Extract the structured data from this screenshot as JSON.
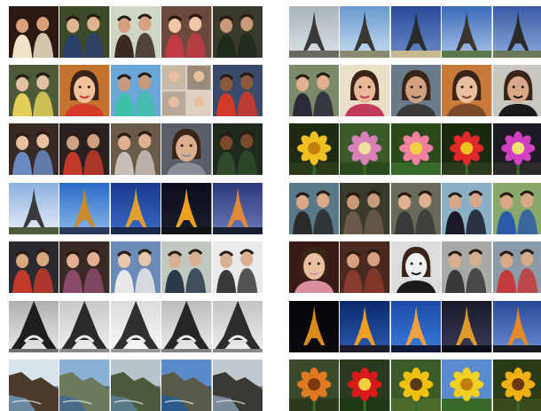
{
  "layout_caption": "",
  "left_column": {
    "rows": [
      {
        "name": "row-1-people-night",
        "tiles": [
          {
            "kind": "people",
            "bg": "#2a1a12",
            "fg": "#d9a07a",
            "accent": "#f2e3c8"
          },
          {
            "kind": "people",
            "bg": "#3c4a2a",
            "fg": "#e0b48f",
            "accent": "#2b3f6b"
          },
          {
            "kind": "people",
            "bg": "#cfd6c3",
            "fg": "#d6a17d",
            "accent": "#3a2a22"
          },
          {
            "kind": "people",
            "bg": "#6b4a3c",
            "fg": "#f0c8a8",
            "accent": "#c23a44"
          },
          {
            "kind": "people",
            "bg": "#3a3a2a",
            "fg": "#c89a7a",
            "accent": "#1e2a1a"
          }
        ]
      },
      {
        "name": "row-2-portraits",
        "tiles": [
          {
            "kind": "people",
            "bg": "#4c5a3a",
            "fg": "#e0c0a0",
            "accent": "#e2d05a"
          },
          {
            "kind": "portrait",
            "bg": "#c2742e",
            "fg": "#f2c39a",
            "accent": "#d23a2a"
          },
          {
            "kind": "people",
            "bg": "#6aa6d8",
            "fg": "#c89a7a",
            "accent": "#3ec0a8"
          },
          {
            "kind": "collage",
            "bg": "#d8d2c8",
            "fg": "#e8c0a0",
            "accent": "#7a5a48"
          },
          {
            "kind": "people",
            "bg": "#3a4a6a",
            "fg": "#8a5a3a",
            "accent": "#d43a2a"
          }
        ]
      },
      {
        "name": "row-3-indoor",
        "tiles": [
          {
            "kind": "people",
            "bg": "#3a2a24",
            "fg": "#e8c0a0",
            "accent": "#6a8ac0"
          },
          {
            "kind": "people",
            "bg": "#2a2220",
            "fg": "#d0a080",
            "accent": "#c23a2a"
          },
          {
            "kind": "people",
            "bg": "#6a5a4a",
            "fg": "#e0b090",
            "accent": "#c8c0b8"
          },
          {
            "kind": "portrait",
            "bg": "#5a5e68",
            "fg": "#d8b090",
            "accent": "#8a8e98"
          },
          {
            "kind": "people",
            "bg": "#1e2a1e",
            "fg": "#7a4a2a",
            "accent": "#2e4a2a"
          }
        ]
      },
      {
        "name": "row-4-eiffel-dusk",
        "tiles": [
          {
            "kind": "tower",
            "sky": "#8ab0e0",
            "sky2": "#e8eef6",
            "tower": "#3a3a3a",
            "ground": "#4a5a3a"
          },
          {
            "kind": "tower",
            "sky": "#2a6ac8",
            "sky2": "#8ab8e8",
            "tower": "#c88a2a",
            "ground": "#2a3a5a"
          },
          {
            "kind": "tower",
            "sky": "#1a3a8a",
            "sky2": "#3a6ac8",
            "tower": "#e0a030",
            "ground": "#1a2a4a"
          },
          {
            "kind": "tower",
            "sky": "#0a0e1a",
            "sky2": "#1a1e2e",
            "tower": "#f0a020",
            "ground": "#101418"
          },
          {
            "kind": "tower",
            "sky": "#2a3a7a",
            "sky2": "#6a7ab8",
            "tower": "#e08a3a",
            "ground": "#1a2030"
          }
        ]
      },
      {
        "name": "row-5-groups",
        "tiles": [
          {
            "kind": "people",
            "bg": "#2a2a30",
            "fg": "#d8a880",
            "accent": "#c23a2a"
          },
          {
            "kind": "people",
            "bg": "#3a2a26",
            "fg": "#e0b090",
            "accent": "#8a4a6a"
          },
          {
            "kind": "people",
            "bg": "#6a8ab8",
            "fg": "#e8c8a8",
            "accent": "#e8e8e8"
          },
          {
            "kind": "people",
            "bg": "#c0c8c0",
            "fg": "#d8b090",
            "accent": "#2a3a4a"
          },
          {
            "kind": "people",
            "bg": "#e8eaec",
            "fg": "#d8b090",
            "accent": "#3a3a3a"
          }
        ]
      },
      {
        "name": "row-6-eiffel-bw",
        "tiles": [
          {
            "kind": "towerbase",
            "sky": "#b0b0b0",
            "sky2": "#e8e8e8",
            "tower": "#1e1e1e",
            "ground": "#707070"
          },
          {
            "kind": "towerbase",
            "sky": "#c8c8c8",
            "sky2": "#f0f0f0",
            "tower": "#2a2a2a",
            "ground": "#8a8a8a"
          },
          {
            "kind": "towerbase",
            "sky": "#dcdcdc",
            "sky2": "#f8f8f8",
            "tower": "#303030",
            "ground": "#9a9a9a"
          },
          {
            "kind": "towerbase",
            "sky": "#bcbcbc",
            "sky2": "#ececec",
            "tower": "#262626",
            "ground": "#808080"
          },
          {
            "kind": "towerbase",
            "sky": "#c4c4c4",
            "sky2": "#eeeeee",
            "tower": "#2c2c2c",
            "ground": "#888888"
          }
        ]
      },
      {
        "name": "row-7-coast",
        "tiles": [
          {
            "kind": "coast",
            "sky": "#d8e4ec",
            "water": "#6a8aa0",
            "land": "#4a3a2a"
          },
          {
            "kind": "coast",
            "sky": "#8ab0d8",
            "water": "#4a6a8a",
            "land": "#6a7a5a"
          },
          {
            "kind": "coast",
            "sky": "#b8c4cc",
            "water": "#5a7a8a",
            "land": "#4a5a3a"
          },
          {
            "kind": "coast",
            "sky": "#5a8ac8",
            "water": "#2a5a8a",
            "land": "#5a5a4a"
          },
          {
            "kind": "coast",
            "sky": "#c0c8d0",
            "water": "#7a8a98",
            "land": "#3a3a34"
          }
        ]
      }
    ]
  },
  "right_column": {
    "rows": [
      {
        "name": "row-1-eiffel-day",
        "tiles": [
          {
            "kind": "tower",
            "sky": "#a8b4bc",
            "sky2": "#dce2e6",
            "tower": "#3a3a3a",
            "ground": "#6a6a60"
          },
          {
            "kind": "tower",
            "sky": "#6a9ad0",
            "sky2": "#c8dcf0",
            "tower": "#3a3630",
            "ground": "#8a8a70"
          },
          {
            "kind": "tower",
            "sky": "#2a4a9a",
            "sky2": "#6a8ac8",
            "tower": "#2a2a2a",
            "ground": "#c8b890"
          },
          {
            "kind": "tower",
            "sky": "#3a6ab8",
            "sky2": "#a8c4e8",
            "tower": "#3a342a",
            "ground": "#5a7a4a"
          },
          {
            "kind": "tower",
            "sky": "#3a5aa8",
            "sky2": "#8aaad8",
            "tower": "#2a2a2a",
            "ground": "#6a7a5a"
          }
        ]
      },
      {
        "name": "row-2-faces",
        "tiles": [
          {
            "kind": "people",
            "bg": "#7a8a6a",
            "fg": "#e0b090",
            "accent": "#2a2a3a"
          },
          {
            "kind": "portrait",
            "bg": "#eae0c8",
            "fg": "#e8b898",
            "accent": "#c23a5a"
          },
          {
            "kind": "portrait",
            "bg": "#6a7a8a",
            "fg": "#d0a080",
            "accent": "#3a3a3a"
          },
          {
            "kind": "portrait",
            "bg": "#c87a3a",
            "fg": "#e8c0a0",
            "accent": "#7a4a2a"
          },
          {
            "kind": "portrait",
            "bg": "#c8c8c0",
            "fg": "#d8a888",
            "accent": "#1a1a1a"
          }
        ]
      },
      {
        "name": "row-3-flowers",
        "tiles": [
          {
            "kind": "flower",
            "bg": "#1e2a12",
            "petal": "#f0c020",
            "center": "#c08010",
            "ground": "#2a3a18"
          },
          {
            "kind": "flower",
            "bg": "#3a5a2a",
            "petal": "#d880b8",
            "center": "#f0e0a0",
            "ground": "#2a4a1e"
          },
          {
            "kind": "flower",
            "bg": "#2a4a1a",
            "petal": "#f080a0",
            "center": "#f0d040",
            "ground": "#3a6a2a"
          },
          {
            "kind": "flower",
            "bg": "#1a2a10",
            "petal": "#e02a2a",
            "center": "#f0c020",
            "ground": "#2a3a1a"
          },
          {
            "kind": "flower",
            "bg": "#1e1a24",
            "petal": "#d040c0",
            "center": "#f0e070",
            "ground": "#2a2a2a"
          }
        ]
      },
      {
        "name": "row-4-outdoor",
        "tiles": [
          {
            "kind": "people",
            "bg": "#5a7a8a",
            "fg": "#d8a888",
            "accent": "#2a2a2a"
          },
          {
            "kind": "people",
            "bg": "#3a3a2a",
            "fg": "#c89a7a",
            "accent": "#6a5a4a"
          },
          {
            "kind": "people",
            "bg": "#6a6a5a",
            "fg": "#e0b090",
            "accent": "#3a3a3a"
          },
          {
            "kind": "people",
            "bg": "#8ab0c8",
            "fg": "#d8a888",
            "accent": "#1a1a2a"
          },
          {
            "kind": "people",
            "bg": "#8aa86a",
            "fg": "#d8a888",
            "accent": "#2a5aa8"
          }
        ]
      },
      {
        "name": "row-5-portraits",
        "tiles": [
          {
            "kind": "portrait",
            "bg": "#3a1a14",
            "fg": "#e8c0a0",
            "accent": "#d890a0"
          },
          {
            "kind": "people",
            "bg": "#4a2a1e",
            "fg": "#d8a080",
            "accent": "#8a3a2a"
          },
          {
            "kind": "portrait",
            "bg": "#dcdcdc",
            "fg": "#f0f0f0",
            "accent": "#1a1a1a"
          },
          {
            "kind": "people",
            "bg": "#a8aaa8",
            "fg": "#d8b090",
            "accent": "#3a3a3a"
          },
          {
            "kind": "people",
            "bg": "#8a9aa8",
            "fg": "#d8a888",
            "accent": "#c23a3a"
          }
        ]
      },
      {
        "name": "row-6-eiffel-night",
        "tiles": [
          {
            "kind": "tower",
            "sky": "#050508",
            "sky2": "#0a0a10",
            "tower": "#d88a1a",
            "ground": "#0a0a0a"
          },
          {
            "kind": "tower",
            "sky": "#0a2a6a",
            "sky2": "#2a5ab0",
            "tower": "#f0a020",
            "ground": "#1a1a2a"
          },
          {
            "kind": "tower",
            "sky": "#1a4aa8",
            "sky2": "#3a7ad8",
            "tower": "#f0a040",
            "ground": "#10183a"
          },
          {
            "kind": "tower",
            "sky": "#1a1a2a",
            "sky2": "#3a3a5a",
            "tower": "#e09a2a",
            "ground": "#0e0e16"
          },
          {
            "kind": "tower",
            "sky": "#2a4a9a",
            "sky2": "#6a8ad0",
            "tower": "#e08a2a",
            "ground": "#1a1a22"
          }
        ]
      },
      {
        "name": "row-7-flowers",
        "tiles": [
          {
            "kind": "flower",
            "bg": "#3a4a2a",
            "petal": "#e07a20",
            "center": "#7a3a10",
            "ground": "#2a3a1a"
          },
          {
            "kind": "flower",
            "bg": "#2a3a1e",
            "petal": "#d81a1a",
            "center": "#f0d040",
            "ground": "#1e3a14"
          },
          {
            "kind": "flower",
            "bg": "#3a5a2a",
            "petal": "#f0c010",
            "center": "#5a3a10",
            "ground": "#4a6a2a"
          },
          {
            "kind": "flower",
            "bg": "#5a8ad0",
            "petal": "#f0d020",
            "center": "#c08010",
            "ground": "#3a6a2a"
          },
          {
            "kind": "flower",
            "bg": "#2a3a14",
            "petal": "#f0b010",
            "center": "#6a3a0a",
            "ground": "#3a4a1a"
          }
        ]
      }
    ]
  }
}
